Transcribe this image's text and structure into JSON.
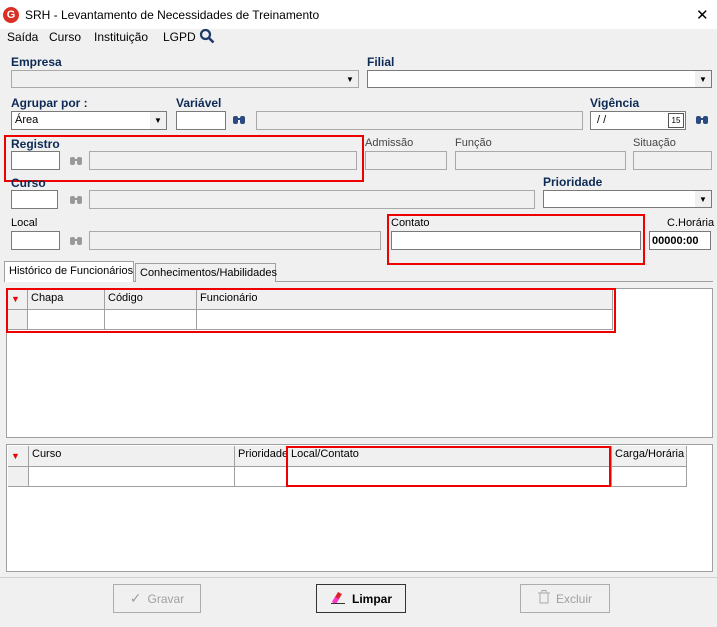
{
  "window": {
    "title": "SRH - Levantamento de Necessidades de Treinamento",
    "icon_letter": "G"
  },
  "menu": [
    {
      "label": "Saída"
    },
    {
      "label": "Curso"
    },
    {
      "label": "Instituição"
    },
    {
      "label": "LGPD"
    }
  ],
  "form": {
    "empresa_label": "Empresa",
    "filial_label": "Filial",
    "agrupar_label": "Agrupar por :",
    "agrupar_value": "Área",
    "variavel_label": "Variável",
    "vigencia_label": "Vigência",
    "vigencia_value": " / /",
    "calendar_day": "15",
    "registro_label": "Registro",
    "admissao_label": "Admissão",
    "funcao_label": "Função",
    "situacao_label": "Situação",
    "curso_label": "Curso",
    "prioridade_label": "Prioridade",
    "local_label": "Local",
    "contato_label": "Contato",
    "choraria_label": "C.Horária",
    "choraria_value": "00000:00"
  },
  "tabs": [
    {
      "label": "Histórico de Funcionários",
      "active": true
    },
    {
      "label": "Conhecimentos/Habilidades",
      "active": false
    }
  ],
  "grid1": {
    "columns": [
      "Chapa",
      "Código",
      "Funcionário"
    ]
  },
  "grid2": {
    "columns": [
      "Curso",
      "Prioridade",
      "Local/Contato",
      "Carga/Horária"
    ]
  },
  "buttons": {
    "gravar": "Gravar",
    "limpar": "Limpar",
    "excluir": "Excluir"
  },
  "colors": {
    "highlight": "#e00000",
    "label_blue": "#0d2a55",
    "sort_arrow": "#e00000"
  }
}
